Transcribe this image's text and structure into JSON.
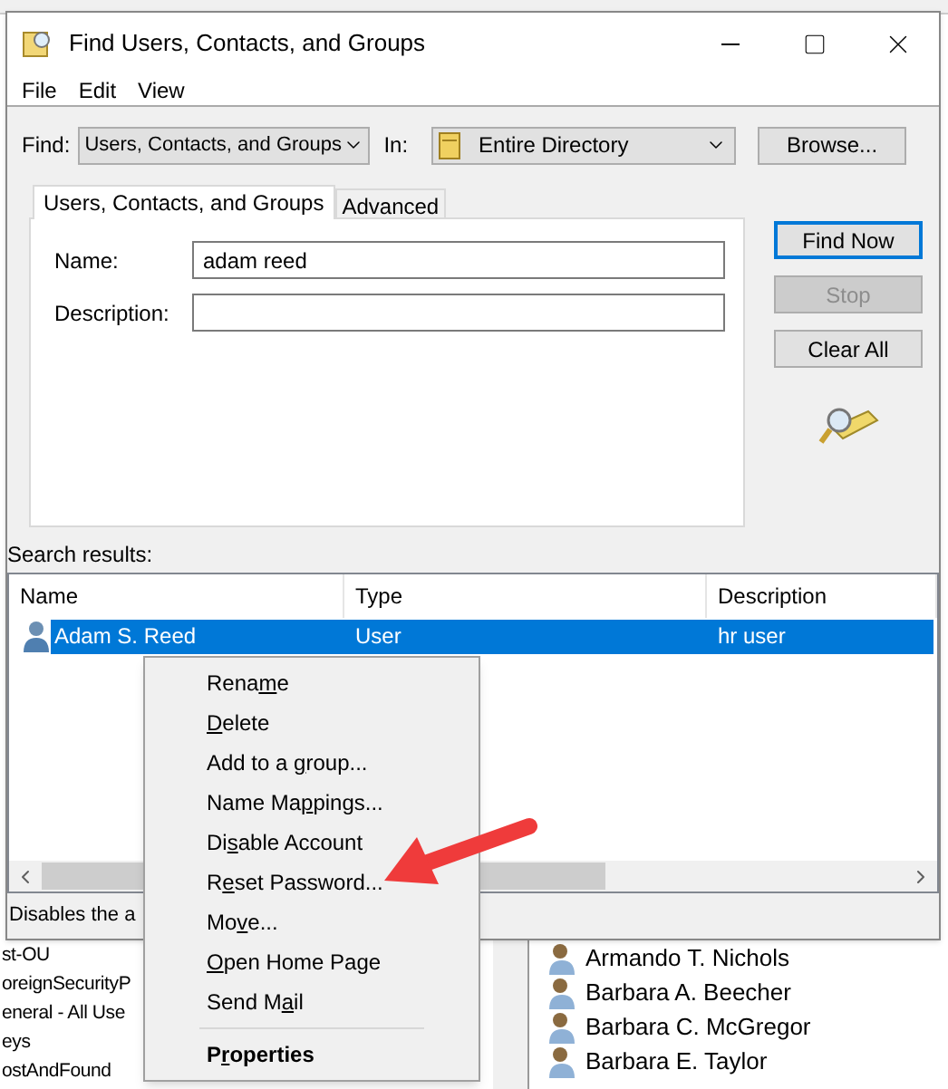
{
  "background_window": {
    "tree_items": [
      "st-OU",
      "oreignSecurityP",
      "eneral - All Use",
      "eys",
      "ostAndFound"
    ],
    "users": [
      "Armando T. Nichols",
      "Barbara A. Beecher",
      "Barbara C. McGregor",
      "Barbara E. Taylor"
    ]
  },
  "dialog": {
    "title": "Find Users, Contacts, and Groups",
    "menu": [
      "File",
      "Edit",
      "View"
    ],
    "find": {
      "label": "Find:",
      "value": "Users, Contacts, and Groups"
    },
    "in": {
      "label": "In:",
      "value": "Entire Directory"
    },
    "browse": "Browse...",
    "tabs": [
      {
        "label": "Users, Contacts, and Groups",
        "selected": true
      },
      {
        "label": "Advanced",
        "selected": false
      }
    ],
    "fields": [
      {
        "label": "Name:",
        "value": "adam reed"
      },
      {
        "label": "Description:"
      }
    ],
    "buttons": [
      {
        "label": "Find Now",
        "disabled": false,
        "default": true
      },
      {
        "label": "Stop",
        "disabled": true,
        "default": false
      },
      {
        "label": "Clear All",
        "disabled": false,
        "default": false
      }
    ],
    "results_label": "Search results:",
    "columns": [
      "Name",
      "Type",
      "Description"
    ],
    "rows": [
      {
        "cells": [
          "Adam S. Reed",
          "User",
          "hr user"
        ],
        "selected": true
      }
    ],
    "status": "Disables the a"
  },
  "context_menu": [
    {
      "kind": "item",
      "before": "Rena",
      "key": "m",
      "after": "e",
      "bold": false
    },
    {
      "kind": "item",
      "key": "D",
      "after": "elete",
      "bold": false
    },
    {
      "kind": "item",
      "before": "Add to a ",
      "key": "g",
      "after": "roup...",
      "bold": false
    },
    {
      "kind": "item",
      "before": "Name Ma",
      "key": "p",
      "after": "pings...",
      "bold": false
    },
    {
      "kind": "item",
      "before": "Di",
      "key": "s",
      "after": "able Account",
      "bold": false
    },
    {
      "kind": "item",
      "before": "R",
      "key": "e",
      "after": "set Password...",
      "bold": false
    },
    {
      "kind": "item",
      "before": "Mo",
      "key": "v",
      "after": "e...",
      "bold": false
    },
    {
      "kind": "item",
      "key": "O",
      "after": "pen Home Page",
      "bold": false
    },
    {
      "kind": "item",
      "before": "Send M",
      "key": "a",
      "after": "il",
      "bold": false
    },
    {
      "kind": "separator"
    },
    {
      "kind": "item",
      "before": "P",
      "key": "r",
      "after": "operties",
      "bold": true
    }
  ]
}
